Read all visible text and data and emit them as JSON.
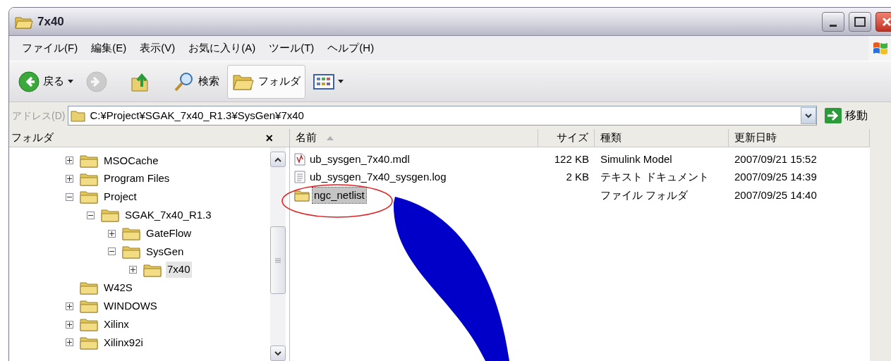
{
  "window": {
    "title": "7x40"
  },
  "menu": [
    "ファイル(F)",
    "編集(E)",
    "表示(V)",
    "お気に入り(A)",
    "ツール(T)",
    "ヘルプ(H)"
  ],
  "toolbar": [
    {
      "kind": "back",
      "label": "戻る",
      "disabled": false,
      "selected": false
    },
    {
      "kind": "forward",
      "disabled": true,
      "selected": false
    },
    {
      "kind": "up",
      "disabled": false,
      "selected": false
    },
    {
      "kind": "search",
      "label": "検索",
      "disabled": false,
      "selected": false
    },
    {
      "kind": "folders",
      "label": "フォルダ",
      "disabled": false,
      "selected": true
    },
    {
      "kind": "views",
      "disabled": false,
      "selected": false
    }
  ],
  "address": {
    "label": "アドレス(D)",
    "value": "C:¥Project¥SGAK_7x40_R1.3¥SysGen¥7x40",
    "go": "移動"
  },
  "folder_pane": {
    "title": "フォルダ",
    "close": "×",
    "items": [
      {
        "label": "MSOCache",
        "kind": "expandable",
        "expanded": false,
        "selected": false
      },
      {
        "label": "Program Files",
        "kind": "expandable",
        "expanded": false,
        "selected": false
      },
      {
        "label": "Project",
        "kind": "expandable",
        "expanded": true,
        "selected": false,
        "children": [
          {
            "label": "SGAK_7x40_R1.3",
            "kind": "expandable",
            "expanded": true,
            "selected": false,
            "children": [
              {
                "label": "GateFlow",
                "kind": "expandable",
                "expanded": false,
                "selected": false
              },
              {
                "label": "SysGen",
                "kind": "expandable",
                "expanded": true,
                "selected": false,
                "children": [
                  {
                    "label": "7x40",
                    "kind": "expandable",
                    "expanded": false,
                    "selected": true
                  }
                ]
              }
            ]
          }
        ]
      },
      {
        "label": "W42S",
        "kind": "leaf",
        "selected": false
      },
      {
        "label": "WINDOWS",
        "kind": "expandable",
        "expanded": false,
        "selected": false
      },
      {
        "label": "Xilinx",
        "kind": "expandable",
        "expanded": false,
        "selected": false
      },
      {
        "label": "Xilinx92i",
        "kind": "expandable",
        "expanded": false,
        "selected": false
      }
    ]
  },
  "table": {
    "columns": [
      {
        "label": "名前",
        "sorted": true
      },
      {
        "label": "サイズ",
        "sorted": false
      },
      {
        "label": "種類",
        "sorted": false
      },
      {
        "label": "更新日時",
        "sorted": false
      }
    ],
    "rows": [
      {
        "kind": "model",
        "name": "ub_sysgen_7x40.mdl",
        "size": "122 KB",
        "type": "Simulink Model",
        "modified": "2007/09/21 15:52",
        "selected": false
      },
      {
        "kind": "text",
        "name": "ub_sysgen_7x40_sysgen.log",
        "size": "2 KB",
        "type": "テキスト ドキュメント",
        "modified": "2007/09/25 14:39",
        "selected": false
      },
      {
        "kind": "folder",
        "name": "ngc_netlist",
        "type": "ファイル フォルダ",
        "modified": "2007/09/25 14:40",
        "selected": true
      }
    ]
  }
}
